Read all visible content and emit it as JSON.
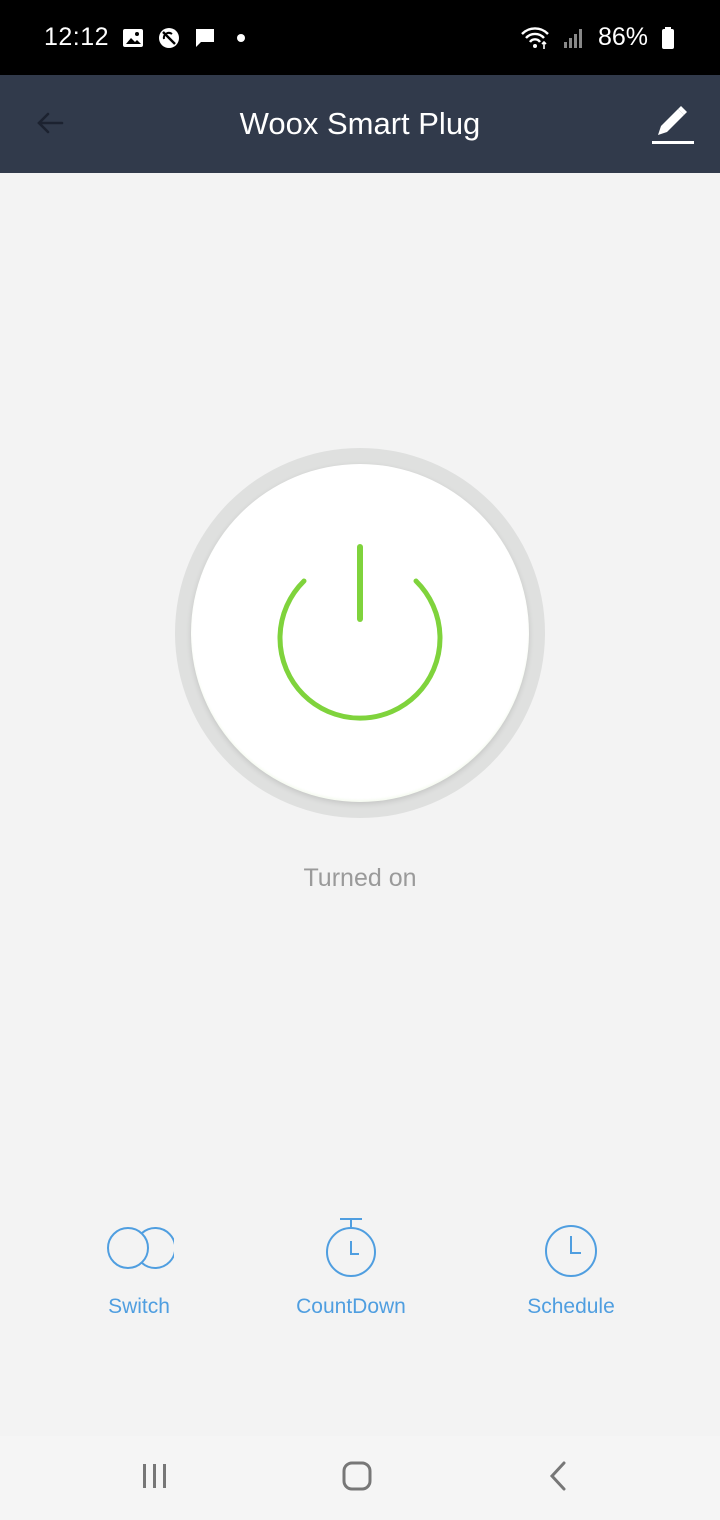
{
  "status_bar": {
    "time": "12:12",
    "battery_percent": "86%",
    "icons": [
      "image-icon",
      "no-sync-icon",
      "chat-icon",
      "dot-icon",
      "wifi-icon",
      "signal-icon",
      "battery-icon"
    ]
  },
  "app_bar": {
    "title": "Woox Smart Plug",
    "back_icon": "back-arrow-icon",
    "edit_icon": "pencil-icon"
  },
  "power": {
    "state_label": "Turned on",
    "accent_color": "#7fd33c"
  },
  "actions": [
    {
      "label": "Switch",
      "icon": "switch-icon"
    },
    {
      "label": "CountDown",
      "icon": "stopwatch-icon"
    },
    {
      "label": "Schedule",
      "icon": "clock-icon"
    }
  ],
  "colors": {
    "app_bar_bg": "#313a4b",
    "action_blue": "#4f9ee0",
    "page_bg": "#f3f3f3"
  },
  "nav_bar": {
    "icons": [
      "recents-icon",
      "home-icon",
      "back-icon"
    ]
  }
}
